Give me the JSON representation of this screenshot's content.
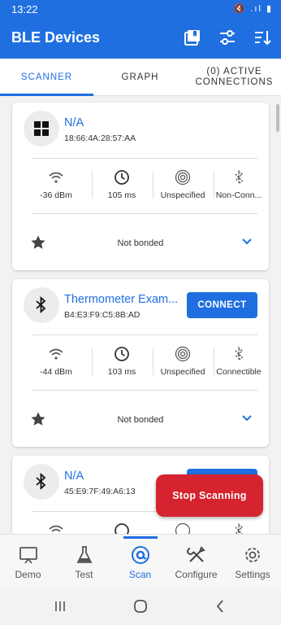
{
  "status": {
    "time": "13:22",
    "icons": "🔇 .ıl ▮"
  },
  "appbar": {
    "title": "BLE Devices"
  },
  "tabs": [
    {
      "label": "SCANNER"
    },
    {
      "label": "GRAPH"
    },
    {
      "label": "(0) ACTIVE CONNECTIONS"
    }
  ],
  "devices": [
    {
      "name": "N/A",
      "mac": "18:66:4A:28:57:AA",
      "icon": "windows-icon",
      "connect": "",
      "rssi": "-36 dBm",
      "interval": "105 ms",
      "tx": "Unspecified",
      "conn": "Non-Conn...",
      "bond": "Not bonded"
    },
    {
      "name": "Thermometer Exam...",
      "mac": "B4:E3:F9:C5:8B:AD",
      "icon": "bluetooth-icon",
      "connect": "CONNECT",
      "rssi": "-44 dBm",
      "interval": "103 ms",
      "tx": "Unspecified",
      "conn": "Connectible",
      "bond": "Not bonded"
    },
    {
      "name": "N/A",
      "mac": "45:E9:7F:49:A6:13",
      "icon": "bluetooth-icon",
      "connect": "",
      "rssi": "",
      "interval": "",
      "tx": "",
      "conn": "",
      "bond": ""
    }
  ],
  "fab": {
    "label": "Stop Scanning"
  },
  "nav": [
    {
      "label": "Demo",
      "icon": "monitor-icon"
    },
    {
      "label": "Test",
      "icon": "flask-icon"
    },
    {
      "label": "Scan",
      "icon": "scan-icon"
    },
    {
      "label": "Configure",
      "icon": "tools-icon"
    },
    {
      "label": "Settings",
      "icon": "gear-icon"
    }
  ],
  "colors": {
    "primary": "#1f6fe0",
    "danger": "#d5232f"
  }
}
